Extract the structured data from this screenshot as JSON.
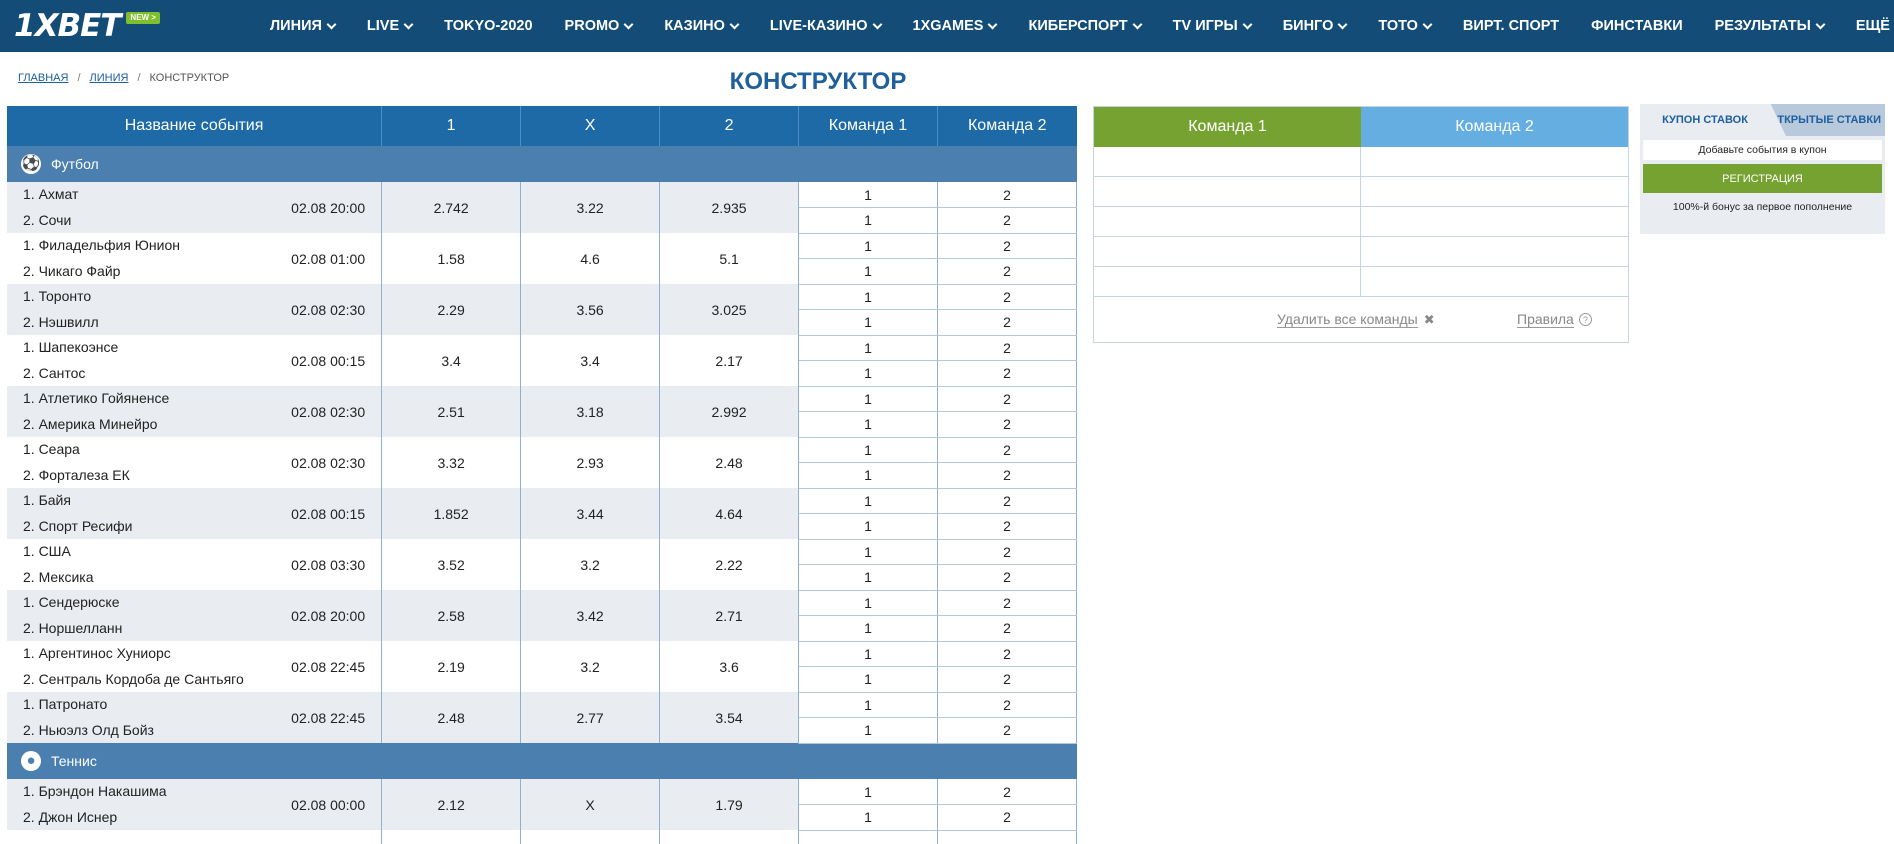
{
  "header": {
    "logo": "1XBET",
    "new_badge": "NEW >",
    "nav": [
      {
        "label": "ЛИНИЯ",
        "chevron": true
      },
      {
        "label": "LIVE",
        "chevron": true
      },
      {
        "label": "TOKYO-2020",
        "chevron": false
      },
      {
        "label": "PROMO",
        "chevron": true
      },
      {
        "label": "КАЗИНО",
        "chevron": true
      },
      {
        "label": "LIVE-КАЗИНО",
        "chevron": true
      },
      {
        "label": "1XGAMES",
        "chevron": true
      },
      {
        "label": "КИБЕРСПОРТ",
        "chevron": true
      },
      {
        "label": "TV ИГРЫ",
        "chevron": true
      },
      {
        "label": "БИНГО",
        "chevron": true
      },
      {
        "label": "ТОТО",
        "chevron": true
      },
      {
        "label": "ВИРТ. СПОРТ",
        "chevron": false
      },
      {
        "label": "ФИНСТАВКИ",
        "chevron": false
      },
      {
        "label": "РЕЗУЛЬТАТЫ",
        "chevron": true
      },
      {
        "label": "ЕЩЁ",
        "chevron": true
      }
    ]
  },
  "breadcrumb": {
    "home": "ГЛАВНАЯ",
    "line": "ЛИНИЯ",
    "current": "КОНСТРУКТОР",
    "sep": "/"
  },
  "page_title": "КОНСТРУКТОР",
  "table": {
    "columns": [
      "Название события",
      "1",
      "X",
      "2",
      "Команда 1",
      "Команда 2"
    ],
    "pick_labels": [
      "1",
      "2"
    ],
    "sports": [
      {
        "name": "Футбол",
        "icon": "soccer-ball-icon",
        "events": [
          {
            "team1": "1. Ахмат",
            "team2": "2. Сочи",
            "time": "02.08 20:00",
            "o1": "2.742",
            "ox": "3.22",
            "o2": "2.935"
          },
          {
            "team1": "1. Филадельфия Юнион",
            "team2": "2. Чикаго Файр",
            "time": "02.08 01:00",
            "o1": "1.58",
            "ox": "4.6",
            "o2": "5.1"
          },
          {
            "team1": "1. Торонто",
            "team2": "2. Нэшвилл",
            "time": "02.08 02:30",
            "o1": "2.29",
            "ox": "3.56",
            "o2": "3.025"
          },
          {
            "team1": "1. Шапекоэнсе",
            "team2": "2. Сантос",
            "time": "02.08 00:15",
            "o1": "3.4",
            "ox": "3.4",
            "o2": "2.17"
          },
          {
            "team1": "1. Атлетико Гойяненсе",
            "team2": "2. Америка Минейро",
            "time": "02.08 02:30",
            "o1": "2.51",
            "ox": "3.18",
            "o2": "2.992"
          },
          {
            "team1": "1. Сеара",
            "team2": "2. Форталеза ЕК",
            "time": "02.08 02:30",
            "o1": "3.32",
            "ox": "2.93",
            "o2": "2.48"
          },
          {
            "team1": "1. Байя",
            "team2": "2. Спорт Ресифи",
            "time": "02.08 00:15",
            "o1": "1.852",
            "ox": "3.44",
            "o2": "4.64"
          },
          {
            "team1": "1. США",
            "team2": "2. Мексика",
            "time": "02.08 03:30",
            "o1": "3.52",
            "ox": "3.2",
            "o2": "2.22"
          },
          {
            "team1": "1. Сендерюске",
            "team2": "2. Норшелланн",
            "time": "02.08 20:00",
            "o1": "2.58",
            "ox": "3.42",
            "o2": "2.71"
          },
          {
            "team1": "1. Аргентинос Хуниорс",
            "team2": "2. Сентраль Кордоба де Сантьяго",
            "time": "02.08 22:45",
            "o1": "2.19",
            "ox": "3.2",
            "o2": "3.6"
          },
          {
            "team1": "1. Патронато",
            "team2": "2. Ньюэлз Олд Бойз",
            "time": "02.08 22:45",
            "o1": "2.48",
            "ox": "2.77",
            "o2": "3.54"
          }
        ]
      },
      {
        "name": "Теннис",
        "icon": "tennis-ball-icon",
        "events": [
          {
            "team1": "1. Брэндон Накашима",
            "team2": "2. Джон Иснер",
            "time": "02.08 00:00",
            "o1": "2.12",
            "ox": "X",
            "o2": "1.79"
          },
          {
            "team1": "",
            "team2": "",
            "time": "",
            "o1": "",
            "ox": "",
            "o2": ""
          }
        ]
      }
    ]
  },
  "builder": {
    "team1_header": "Команда 1",
    "team2_header": "Команда 2",
    "delete_all": "Удалить все команды",
    "rules": "Правила"
  },
  "coupon": {
    "tab_coupon": "КУПОН СТАВОК",
    "tab_open": "ОТКРЫТЫЕ СТАВКИ",
    "empty_text": "Добавьте события в купон",
    "register": "РЕГИСТРАЦИЯ",
    "bonus": "100%-й бонус за первое пополнение"
  },
  "colors": {
    "topbar": "#144c78",
    "table_header": "#1d6aa6",
    "sport_row": "#4a7fb0",
    "team1_green": "#76a232",
    "team2_blue": "#64aee2"
  }
}
